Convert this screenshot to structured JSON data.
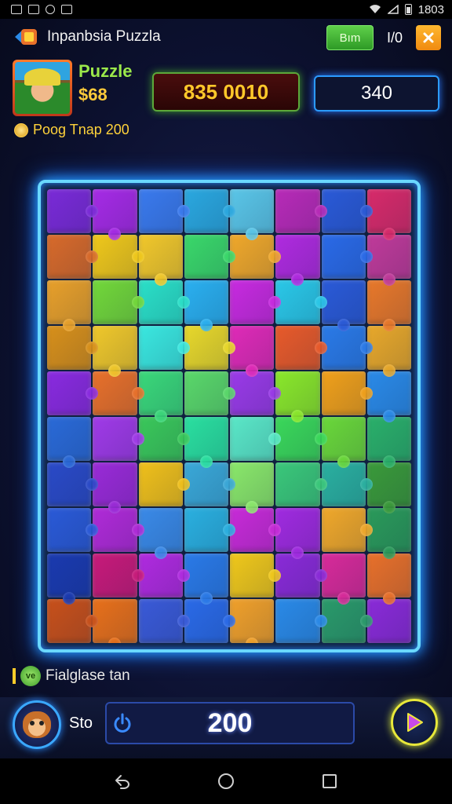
{
  "status_bar": {
    "time": "1803"
  },
  "header": {
    "title": "Inpanbsia Puzzla",
    "green_button_label": "Bım",
    "level_label": "I/0"
  },
  "player": {
    "name": "Puzzle",
    "coins": "$68",
    "bonus_text": "Poog Tnap 200"
  },
  "score": {
    "value": "835 0010"
  },
  "moves": {
    "value": "340"
  },
  "board": {
    "pieces": [
      "#7a2ad8",
      "#a62ae6",
      "#3a7aee",
      "#2aa8e0",
      "#5ac6e8",
      "#b82ab8",
      "#2a5ad8",
      "#d82a6a",
      "#d86a2a",
      "#f0c81a",
      "#f2c82a",
      "#3ad86a",
      "#f0a82a",
      "#b02ae0",
      "#2a6ae8",
      "#c03a9a",
      "#e8a02a",
      "#72d83a",
      "#2ae0c8",
      "#2ab0f0",
      "#c82ae0",
      "#2ac8e8",
      "#2a5ad8",
      "#e8782a",
      "#d8901a",
      "#f0c82a",
      "#3ae8e0",
      "#e8d82a",
      "#e02ab8",
      "#e85a2a",
      "#2a7ae8",
      "#e8a82a",
      "#8a2ae0",
      "#e8702a",
      "#3ad87a",
      "#5ad86a",
      "#9a3ae8",
      "#8ae82a",
      "#f0a01a",
      "#2a8ae8",
      "#2a6ad8",
      "#a03ae8",
      "#3ac85a",
      "#2ae0a0",
      "#5ae8c8",
      "#3ad85a",
      "#6ad83a",
      "#2ab06a",
      "#2a4ac8",
      "#9a2ad8",
      "#f0c01a",
      "#3aa8d8",
      "#8ae86a",
      "#3ac87a",
      "#2ab0a0",
      "#3a9a3a",
      "#2a5ad8",
      "#b02ad8",
      "#3a8ae8",
      "#2ab0e0",
      "#c82ad8",
      "#a02ae0",
      "#f0a82a",
      "#2a9a5a",
      "#1a3ab0",
      "#c81a7a",
      "#b02ae0",
      "#2a7ae8",
      "#f0c81a",
      "#8a2ad8",
      "#d82a9a",
      "#e8702a",
      "#c8501a",
      "#e8701a",
      "#3a5ad8",
      "#2a6ae8",
      "#f0a02a",
      "#2a8ae8",
      "#2a9a6a",
      "#8a2ad8"
    ]
  },
  "hint": {
    "text": "Fialglase tan",
    "badge": "ve"
  },
  "bottom": {
    "label": "Sto",
    "value": "200"
  },
  "colors": {
    "accent_blue": "#2b9bff",
    "score_gold": "#ffc82a",
    "name_green": "#9be84a"
  }
}
